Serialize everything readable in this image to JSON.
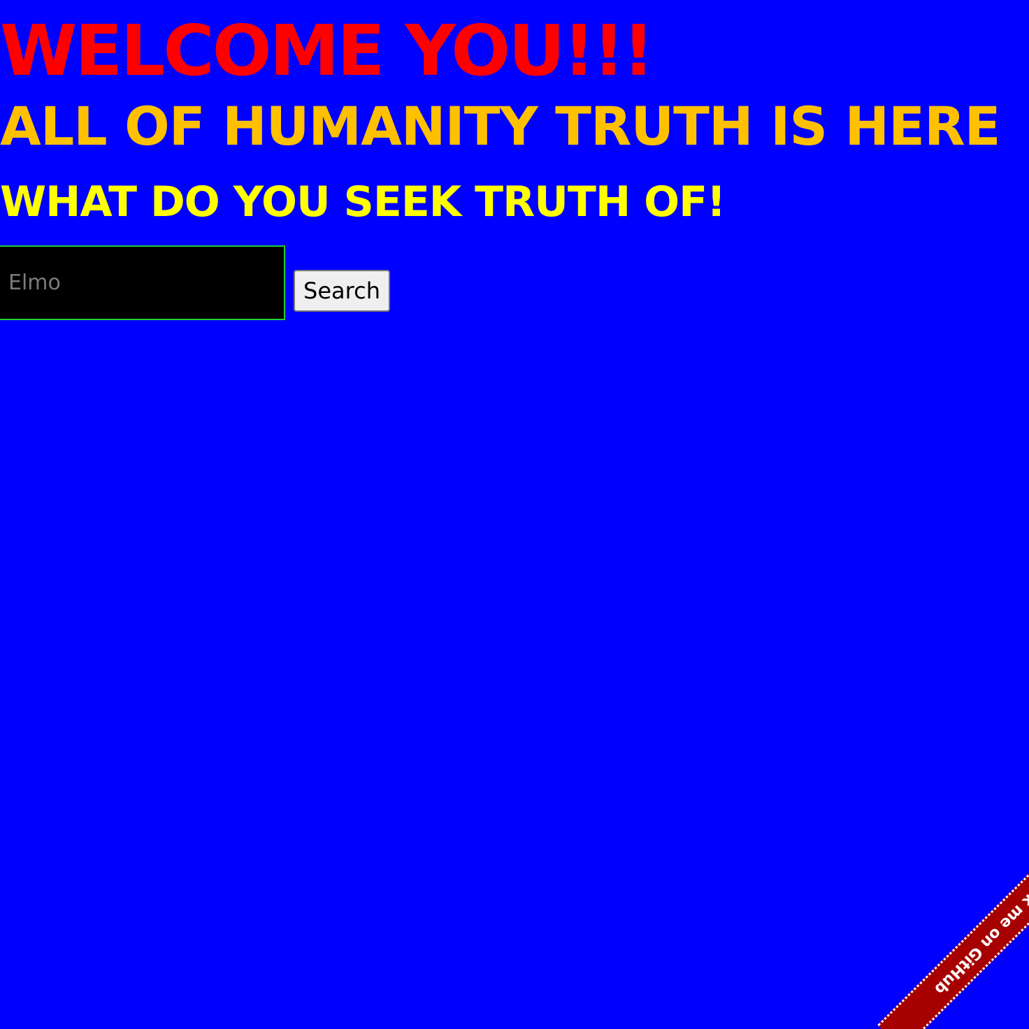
{
  "colors": {
    "background": "#0000ff",
    "welcome_text": "#ff0000",
    "humanity_text": "#ffc000",
    "seek_text": "#ffff00",
    "input_background": "#000000",
    "input_border": "#22cc33",
    "ribbon": "#a60000"
  },
  "headings": {
    "welcome": "WELCOME YOU!!!",
    "humanity": "ALL OF HUMANITY TRUTH IS HERE",
    "seek": "WHAT DO YOU SEEK TRUTH OF!"
  },
  "search": {
    "placeholder": "Elmo",
    "value": "",
    "button_label": "Search"
  },
  "ribbon": {
    "label": "Fork me on GitHub"
  }
}
